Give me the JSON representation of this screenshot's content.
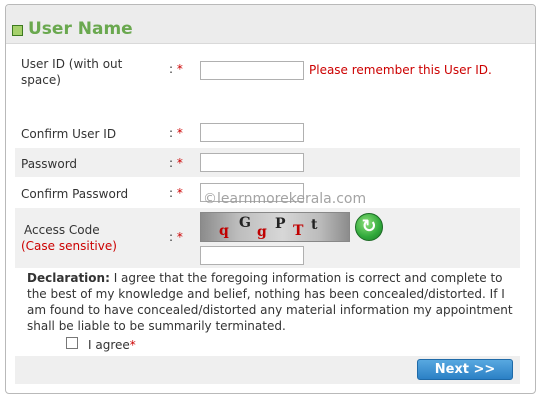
{
  "header": {
    "title": "User Name"
  },
  "fields": {
    "user_id": {
      "label": "User ID (with out space)",
      "value": "",
      "note": "Please remember this User ID."
    },
    "confirm_user_id": {
      "label": "Confirm User ID",
      "value": ""
    },
    "password": {
      "label": "Password",
      "value": ""
    },
    "confirm_password": {
      "label": "Confirm Password",
      "value": ""
    },
    "access_code": {
      "label": "Access Code",
      "sublabel": "(Case sensitive)",
      "value": ""
    }
  },
  "colon": ":",
  "required_mark": "*",
  "captcha": {
    "chars": [
      "q",
      "G",
      "g",
      "P",
      "T",
      "t"
    ]
  },
  "declaration": {
    "heading": "Declaration:",
    "text": "I agree that the foregoing information is correct and complete to the best of my knowledge and belief, nothing has been concealed/distorted. If I am found to have concealed/distorted any material information my appointment shall be liable to be summarily terminated."
  },
  "agree": {
    "label": "I agree",
    "checked": false
  },
  "buttons": {
    "next": "Next >>"
  },
  "watermark": "©learnmorekerala.com"
}
